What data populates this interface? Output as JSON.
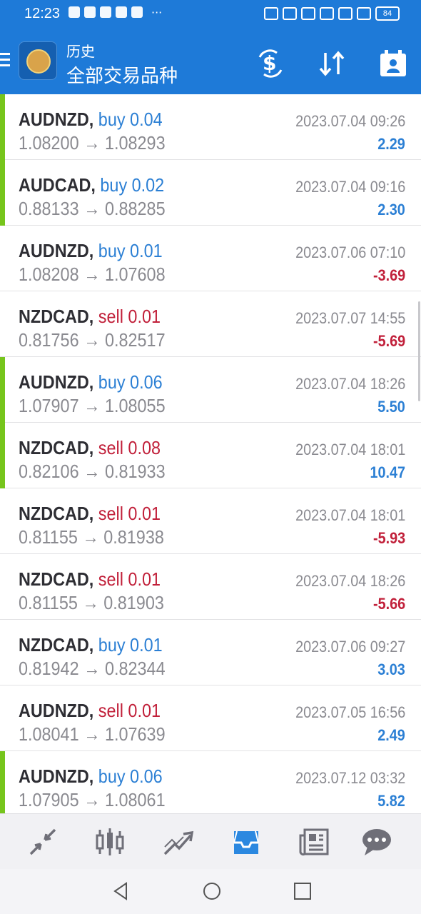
{
  "status_bar": {
    "time": "12:23",
    "battery": "84"
  },
  "header": {
    "title": "历史",
    "subtitle": "全部交易品种"
  },
  "trades": [
    {
      "symbol": "AUDNZD,",
      "side": "buy",
      "lots": "0.04",
      "open": "1.08200",
      "close": "1.08293",
      "datetime": "2023.07.04 09:26",
      "profit": "2.29",
      "highlight": true
    },
    {
      "symbol": "AUDCAD,",
      "side": "buy",
      "lots": "0.02",
      "open": "0.88133",
      "close": "0.88285",
      "datetime": "2023.07.04 09:16",
      "profit": "2.30",
      "highlight": true
    },
    {
      "symbol": "AUDNZD,",
      "side": "buy",
      "lots": "0.01",
      "open": "1.08208",
      "close": "1.07608",
      "datetime": "2023.07.06 07:10",
      "profit": "-3.69",
      "highlight": false
    },
    {
      "symbol": "NZDCAD,",
      "side": "sell",
      "lots": "0.01",
      "open": "0.81756",
      "close": "0.82517",
      "datetime": "2023.07.07 14:55",
      "profit": "-5.69",
      "highlight": false
    },
    {
      "symbol": "AUDNZD,",
      "side": "buy",
      "lots": "0.06",
      "open": "1.07907",
      "close": "1.08055",
      "datetime": "2023.07.04 18:26",
      "profit": "5.50",
      "highlight": true
    },
    {
      "symbol": "NZDCAD,",
      "side": "sell",
      "lots": "0.08",
      "open": "0.82106",
      "close": "0.81933",
      "datetime": "2023.07.04 18:01",
      "profit": "10.47",
      "highlight": true
    },
    {
      "symbol": "NZDCAD,",
      "side": "sell",
      "lots": "0.01",
      "open": "0.81155",
      "close": "0.81938",
      "datetime": "2023.07.04 18:01",
      "profit": "-5.93",
      "highlight": false
    },
    {
      "symbol": "NZDCAD,",
      "side": "sell",
      "lots": "0.01",
      "open": "0.81155",
      "close": "0.81903",
      "datetime": "2023.07.04 18:26",
      "profit": "-5.66",
      "highlight": false
    },
    {
      "symbol": "NZDCAD,",
      "side": "buy",
      "lots": "0.01",
      "open": "0.81942",
      "close": "0.82344",
      "datetime": "2023.07.06 09:27",
      "profit": "3.03",
      "highlight": false
    },
    {
      "symbol": "AUDNZD,",
      "side": "sell",
      "lots": "0.01",
      "open": "1.08041",
      "close": "1.07639",
      "datetime": "2023.07.05 16:56",
      "profit": "2.49",
      "highlight": false
    },
    {
      "symbol": "AUDNZD,",
      "side": "buy",
      "lots": "0.06",
      "open": "1.07905",
      "close": "1.08061",
      "datetime": "2023.07.12 03:32",
      "profit": "5.82",
      "highlight": true
    }
  ],
  "colors": {
    "accent": "#1e7ad8",
    "buy": "#2b7fd4",
    "sell": "#c1203a",
    "highlight_bar": "#76c51c"
  },
  "icons": {
    "toolbar": [
      "dollar-sync-icon",
      "sort-icon",
      "calendar-icon"
    ],
    "bottom_nav": [
      "quotes-icon",
      "chart-icon",
      "trade-icon",
      "history-icon",
      "news-icon",
      "chat-icon"
    ],
    "active_tab": "history-icon"
  }
}
